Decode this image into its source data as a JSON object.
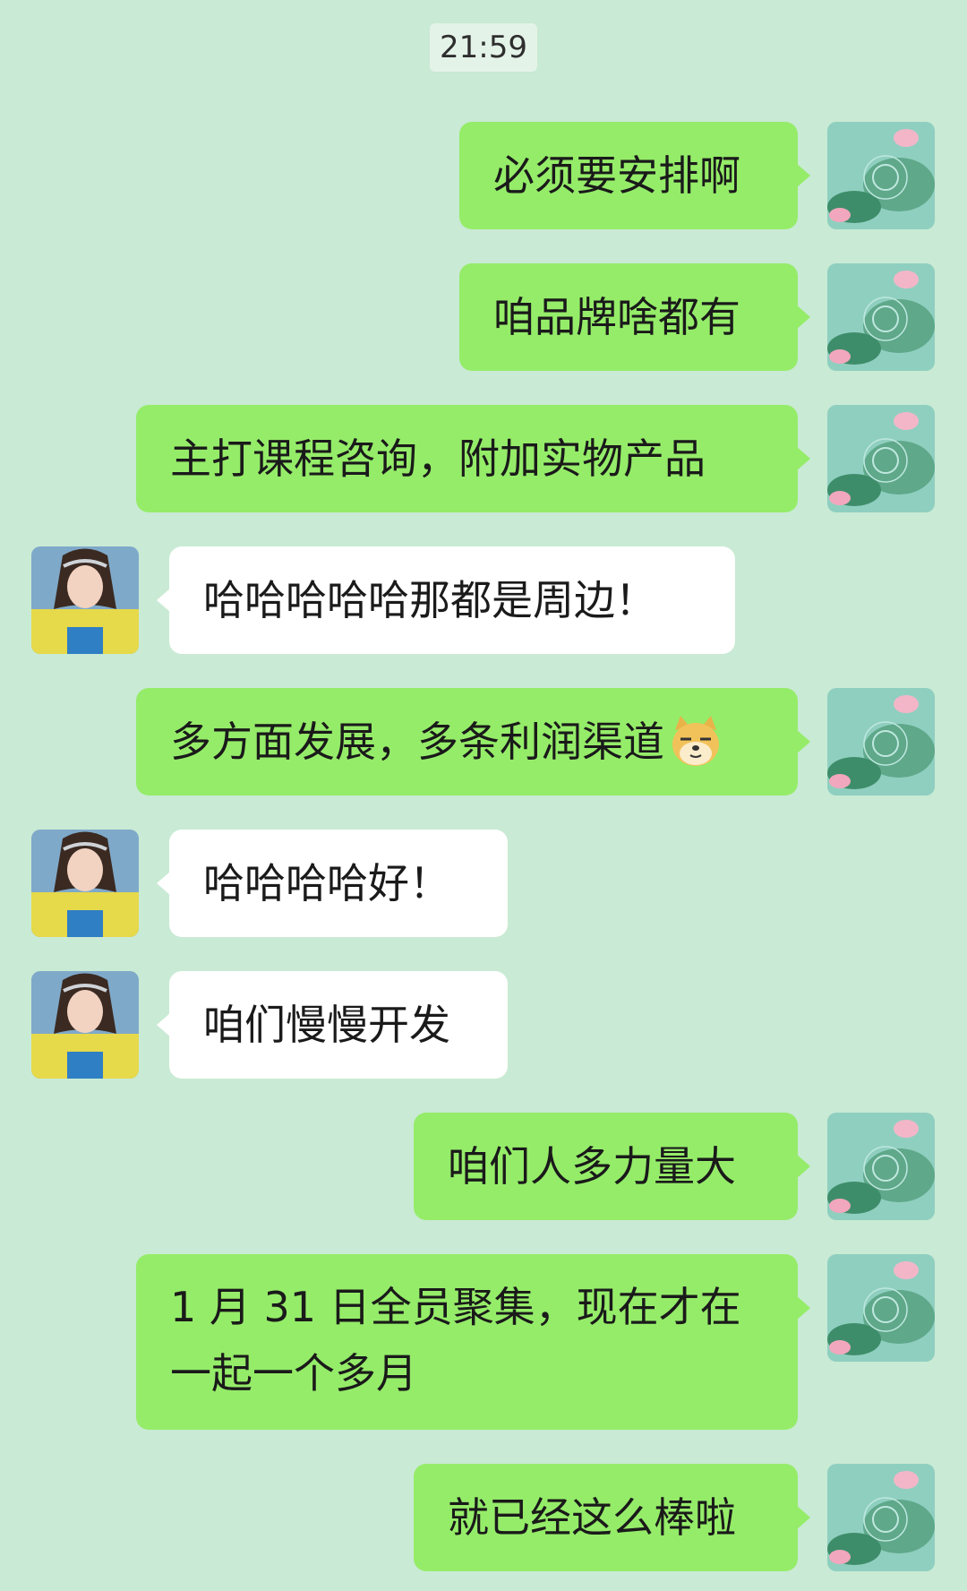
{
  "timestamp": "21:59",
  "messages": [
    {
      "sender": "me",
      "text": "必须要安排啊"
    },
    {
      "sender": "me",
      "text": "咱品牌啥都有"
    },
    {
      "sender": "me",
      "text": "主打课程咨询，附加实物产品"
    },
    {
      "sender": "them",
      "text": "哈哈哈哈哈那都是周边！"
    },
    {
      "sender": "me",
      "text": "多方面发展，多条利润渠道",
      "emoji": "doge-emoji"
    },
    {
      "sender": "them",
      "text": "哈哈哈哈好！"
    },
    {
      "sender": "them",
      "text": "咱们慢慢开发"
    },
    {
      "sender": "me",
      "text": "咱们人多力量大"
    },
    {
      "sender": "me",
      "text": "1 月 31 日全员聚集，现在才在一起一个多月"
    },
    {
      "sender": "me",
      "text": "就已经这么棒啦"
    }
  ],
  "icons": {
    "my_avatar": "lotus-pond-avatar",
    "their_avatar": "girl-portrait-avatar"
  }
}
